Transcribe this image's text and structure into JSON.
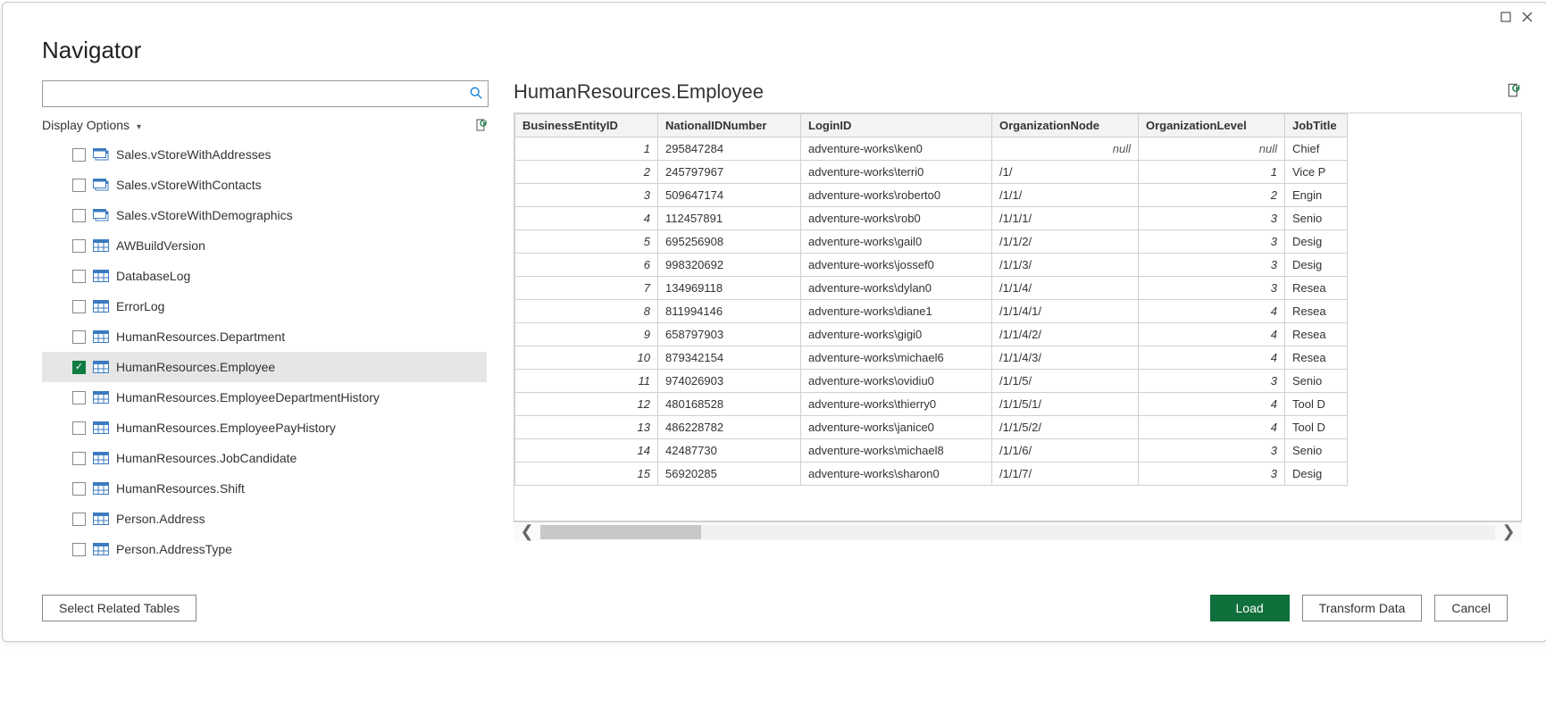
{
  "window": {
    "title": "Navigator"
  },
  "search": {
    "placeholder": ""
  },
  "display_options_label": "Display Options",
  "tree": {
    "items": [
      {
        "label": "Sales.vStoreWithAddresses",
        "type": "view",
        "checked": false
      },
      {
        "label": "Sales.vStoreWithContacts",
        "type": "view",
        "checked": false
      },
      {
        "label": "Sales.vStoreWithDemographics",
        "type": "view",
        "checked": false
      },
      {
        "label": "AWBuildVersion",
        "type": "table",
        "checked": false
      },
      {
        "label": "DatabaseLog",
        "type": "table",
        "checked": false
      },
      {
        "label": "ErrorLog",
        "type": "table",
        "checked": false
      },
      {
        "label": "HumanResources.Department",
        "type": "table",
        "checked": false
      },
      {
        "label": "HumanResources.Employee",
        "type": "table",
        "checked": true,
        "selected": true
      },
      {
        "label": "HumanResources.EmployeeDepartmentHistory",
        "type": "table",
        "checked": false
      },
      {
        "label": "HumanResources.EmployeePayHistory",
        "type": "table",
        "checked": false
      },
      {
        "label": "HumanResources.JobCandidate",
        "type": "table",
        "checked": false
      },
      {
        "label": "HumanResources.Shift",
        "type": "table",
        "checked": false
      },
      {
        "label": "Person.Address",
        "type": "table",
        "checked": false
      },
      {
        "label": "Person.AddressType",
        "type": "table",
        "checked": false
      }
    ]
  },
  "preview": {
    "title": "HumanResources.Employee",
    "null_text": "null",
    "columns": [
      "BusinessEntityID",
      "NationalIDNumber",
      "LoginID",
      "OrganizationNode",
      "OrganizationLevel",
      "JobTitle"
    ],
    "rows": [
      {
        "be": "1",
        "nid": "295847284",
        "login": "adventure-works\\ken0",
        "node": null,
        "lvl": null,
        "job": "Chief"
      },
      {
        "be": "2",
        "nid": "245797967",
        "login": "adventure-works\\terri0",
        "node": "/1/",
        "lvl": "1",
        "job": "Vice P"
      },
      {
        "be": "3",
        "nid": "509647174",
        "login": "adventure-works\\roberto0",
        "node": "/1/1/",
        "lvl": "2",
        "job": "Engin"
      },
      {
        "be": "4",
        "nid": "112457891",
        "login": "adventure-works\\rob0",
        "node": "/1/1/1/",
        "lvl": "3",
        "job": "Senio"
      },
      {
        "be": "5",
        "nid": "695256908",
        "login": "adventure-works\\gail0",
        "node": "/1/1/2/",
        "lvl": "3",
        "job": "Desig"
      },
      {
        "be": "6",
        "nid": "998320692",
        "login": "adventure-works\\jossef0",
        "node": "/1/1/3/",
        "lvl": "3",
        "job": "Desig"
      },
      {
        "be": "7",
        "nid": "134969118",
        "login": "adventure-works\\dylan0",
        "node": "/1/1/4/",
        "lvl": "3",
        "job": "Resea"
      },
      {
        "be": "8",
        "nid": "811994146",
        "login": "adventure-works\\diane1",
        "node": "/1/1/4/1/",
        "lvl": "4",
        "job": "Resea"
      },
      {
        "be": "9",
        "nid": "658797903",
        "login": "adventure-works\\gigi0",
        "node": "/1/1/4/2/",
        "lvl": "4",
        "job": "Resea"
      },
      {
        "be": "10",
        "nid": "879342154",
        "login": "adventure-works\\michael6",
        "node": "/1/1/4/3/",
        "lvl": "4",
        "job": "Resea"
      },
      {
        "be": "11",
        "nid": "974026903",
        "login": "adventure-works\\ovidiu0",
        "node": "/1/1/5/",
        "lvl": "3",
        "job": "Senio"
      },
      {
        "be": "12",
        "nid": "480168528",
        "login": "adventure-works\\thierry0",
        "node": "/1/1/5/1/",
        "lvl": "4",
        "job": "Tool D"
      },
      {
        "be": "13",
        "nid": "486228782",
        "login": "adventure-works\\janice0",
        "node": "/1/1/5/2/",
        "lvl": "4",
        "job": "Tool D"
      },
      {
        "be": "14",
        "nid": "42487730",
        "login": "adventure-works\\michael8",
        "node": "/1/1/6/",
        "lvl": "3",
        "job": "Senio"
      },
      {
        "be": "15",
        "nid": "56920285",
        "login": "adventure-works\\sharon0",
        "node": "/1/1/7/",
        "lvl": "3",
        "job": "Desig"
      }
    ]
  },
  "footer": {
    "select_related": "Select Related Tables",
    "load": "Load",
    "transform": "Transform Data",
    "cancel": "Cancel"
  }
}
